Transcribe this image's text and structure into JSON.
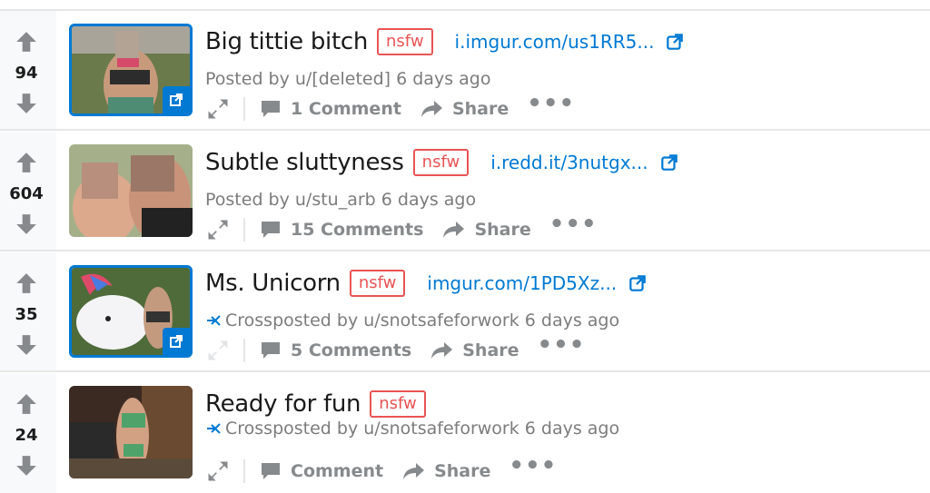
{
  "posts": [
    {
      "score": "94",
      "title": "Big tittie bitch",
      "tag": "nsfw",
      "domain": "i.imgur.com/us1RR5...",
      "meta": "Posted by u/[deleted] 6 days ago",
      "crosspost": false,
      "comments": "1 Comment",
      "share": "Share",
      "more": "•••"
    },
    {
      "score": "604",
      "title": "Subtle sluttyness",
      "tag": "nsfw",
      "domain": "i.redd.it/3nutgx...",
      "meta": "Posted by u/stu_arb 6 days ago",
      "crosspost": false,
      "comments": "15 Comments",
      "share": "Share",
      "more": "•••"
    },
    {
      "score": "35",
      "title": "Ms. Unicorn",
      "tag": "nsfw",
      "domain": "imgur.com/1PD5Xz...",
      "meta": "Crossposted by u/snotsafeforwork 6 days ago",
      "crosspost": true,
      "comments": "5 Comments",
      "share": "Share",
      "more": "•••"
    },
    {
      "score": "24",
      "title": "Ready for fun",
      "tag": "nsfw",
      "domain": "",
      "meta": "Crossposted by u/snotsafeforwork 6 days ago",
      "crosspost": true,
      "comments": "Comment",
      "share": "Share",
      "more": "•••"
    }
  ],
  "colors": {
    "accent": "#0079d3",
    "nsfw": "#e95455",
    "muted": "#878a8c"
  },
  "icons": [
    "upvote-arrow-icon",
    "downvote-arrow-icon",
    "external-link-icon",
    "expand-icon",
    "comment-icon",
    "share-icon",
    "crosspost-icon"
  ]
}
